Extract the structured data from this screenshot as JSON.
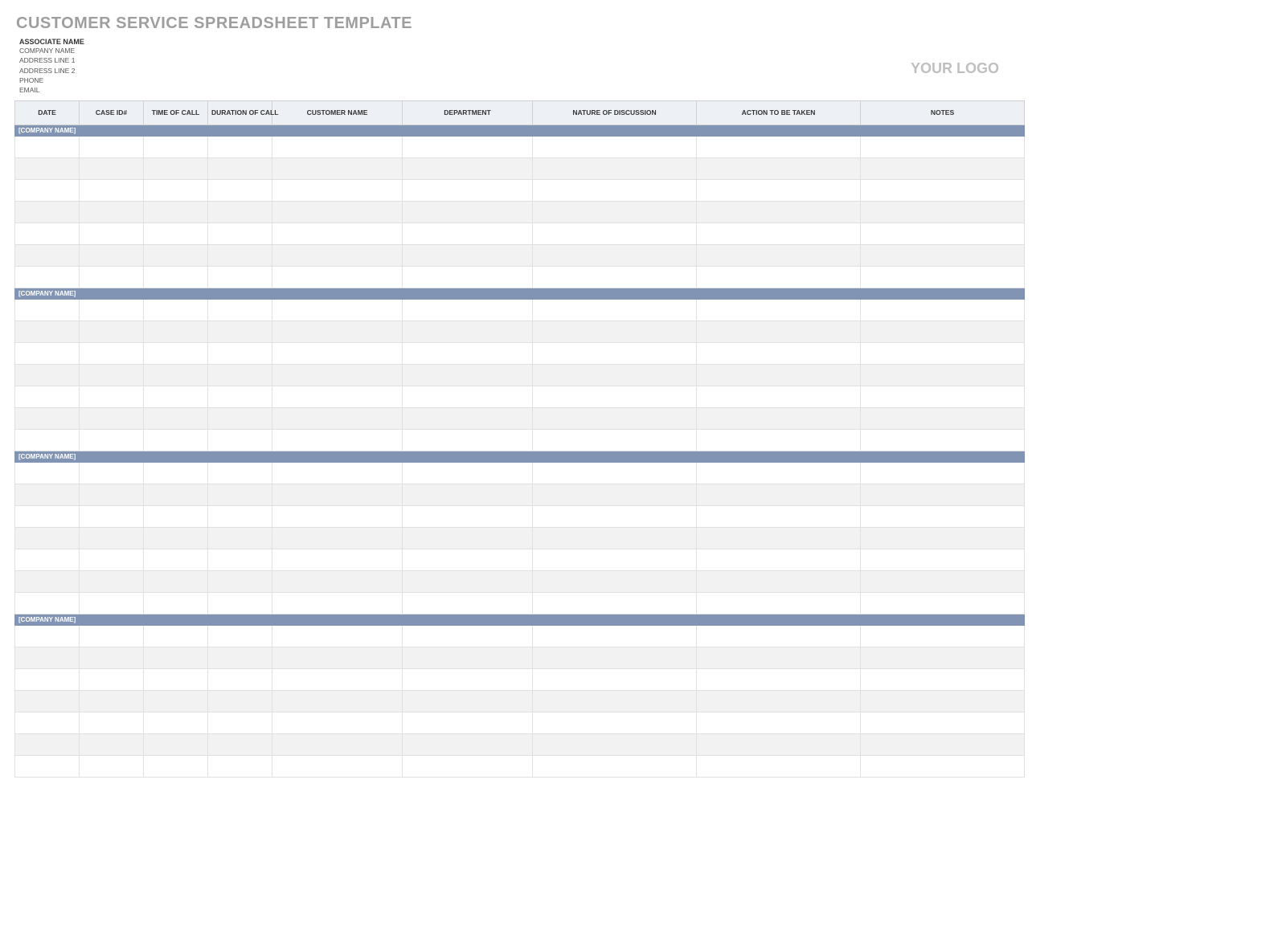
{
  "title": "CUSTOMER SERVICE SPREADSHEET TEMPLATE",
  "logo": "YOUR LOGO",
  "info": {
    "associate": "ASSOCIATE NAME",
    "company": "COMPANY NAME",
    "address1": "ADDRESS LINE 1",
    "address2": "ADDRESS LINE 2",
    "phone": "PHONE",
    "email": "EMAIL"
  },
  "columns": [
    "DATE",
    "CASE ID#",
    "TIME OF CALL",
    "DURATION OF CALL",
    "CUSTOMER NAME",
    "DEPARTMENT",
    "NATURE OF DISCUSSION",
    "ACTION TO BE TAKEN",
    "NOTES"
  ],
  "groups": [
    {
      "label": "[COMPANY NAME]",
      "rows": 7
    },
    {
      "label": "[COMPANY NAME]",
      "rows": 7
    },
    {
      "label": "[COMPANY NAME]",
      "rows": 7
    },
    {
      "label": "[COMPANY NAME]",
      "rows": 7
    }
  ]
}
